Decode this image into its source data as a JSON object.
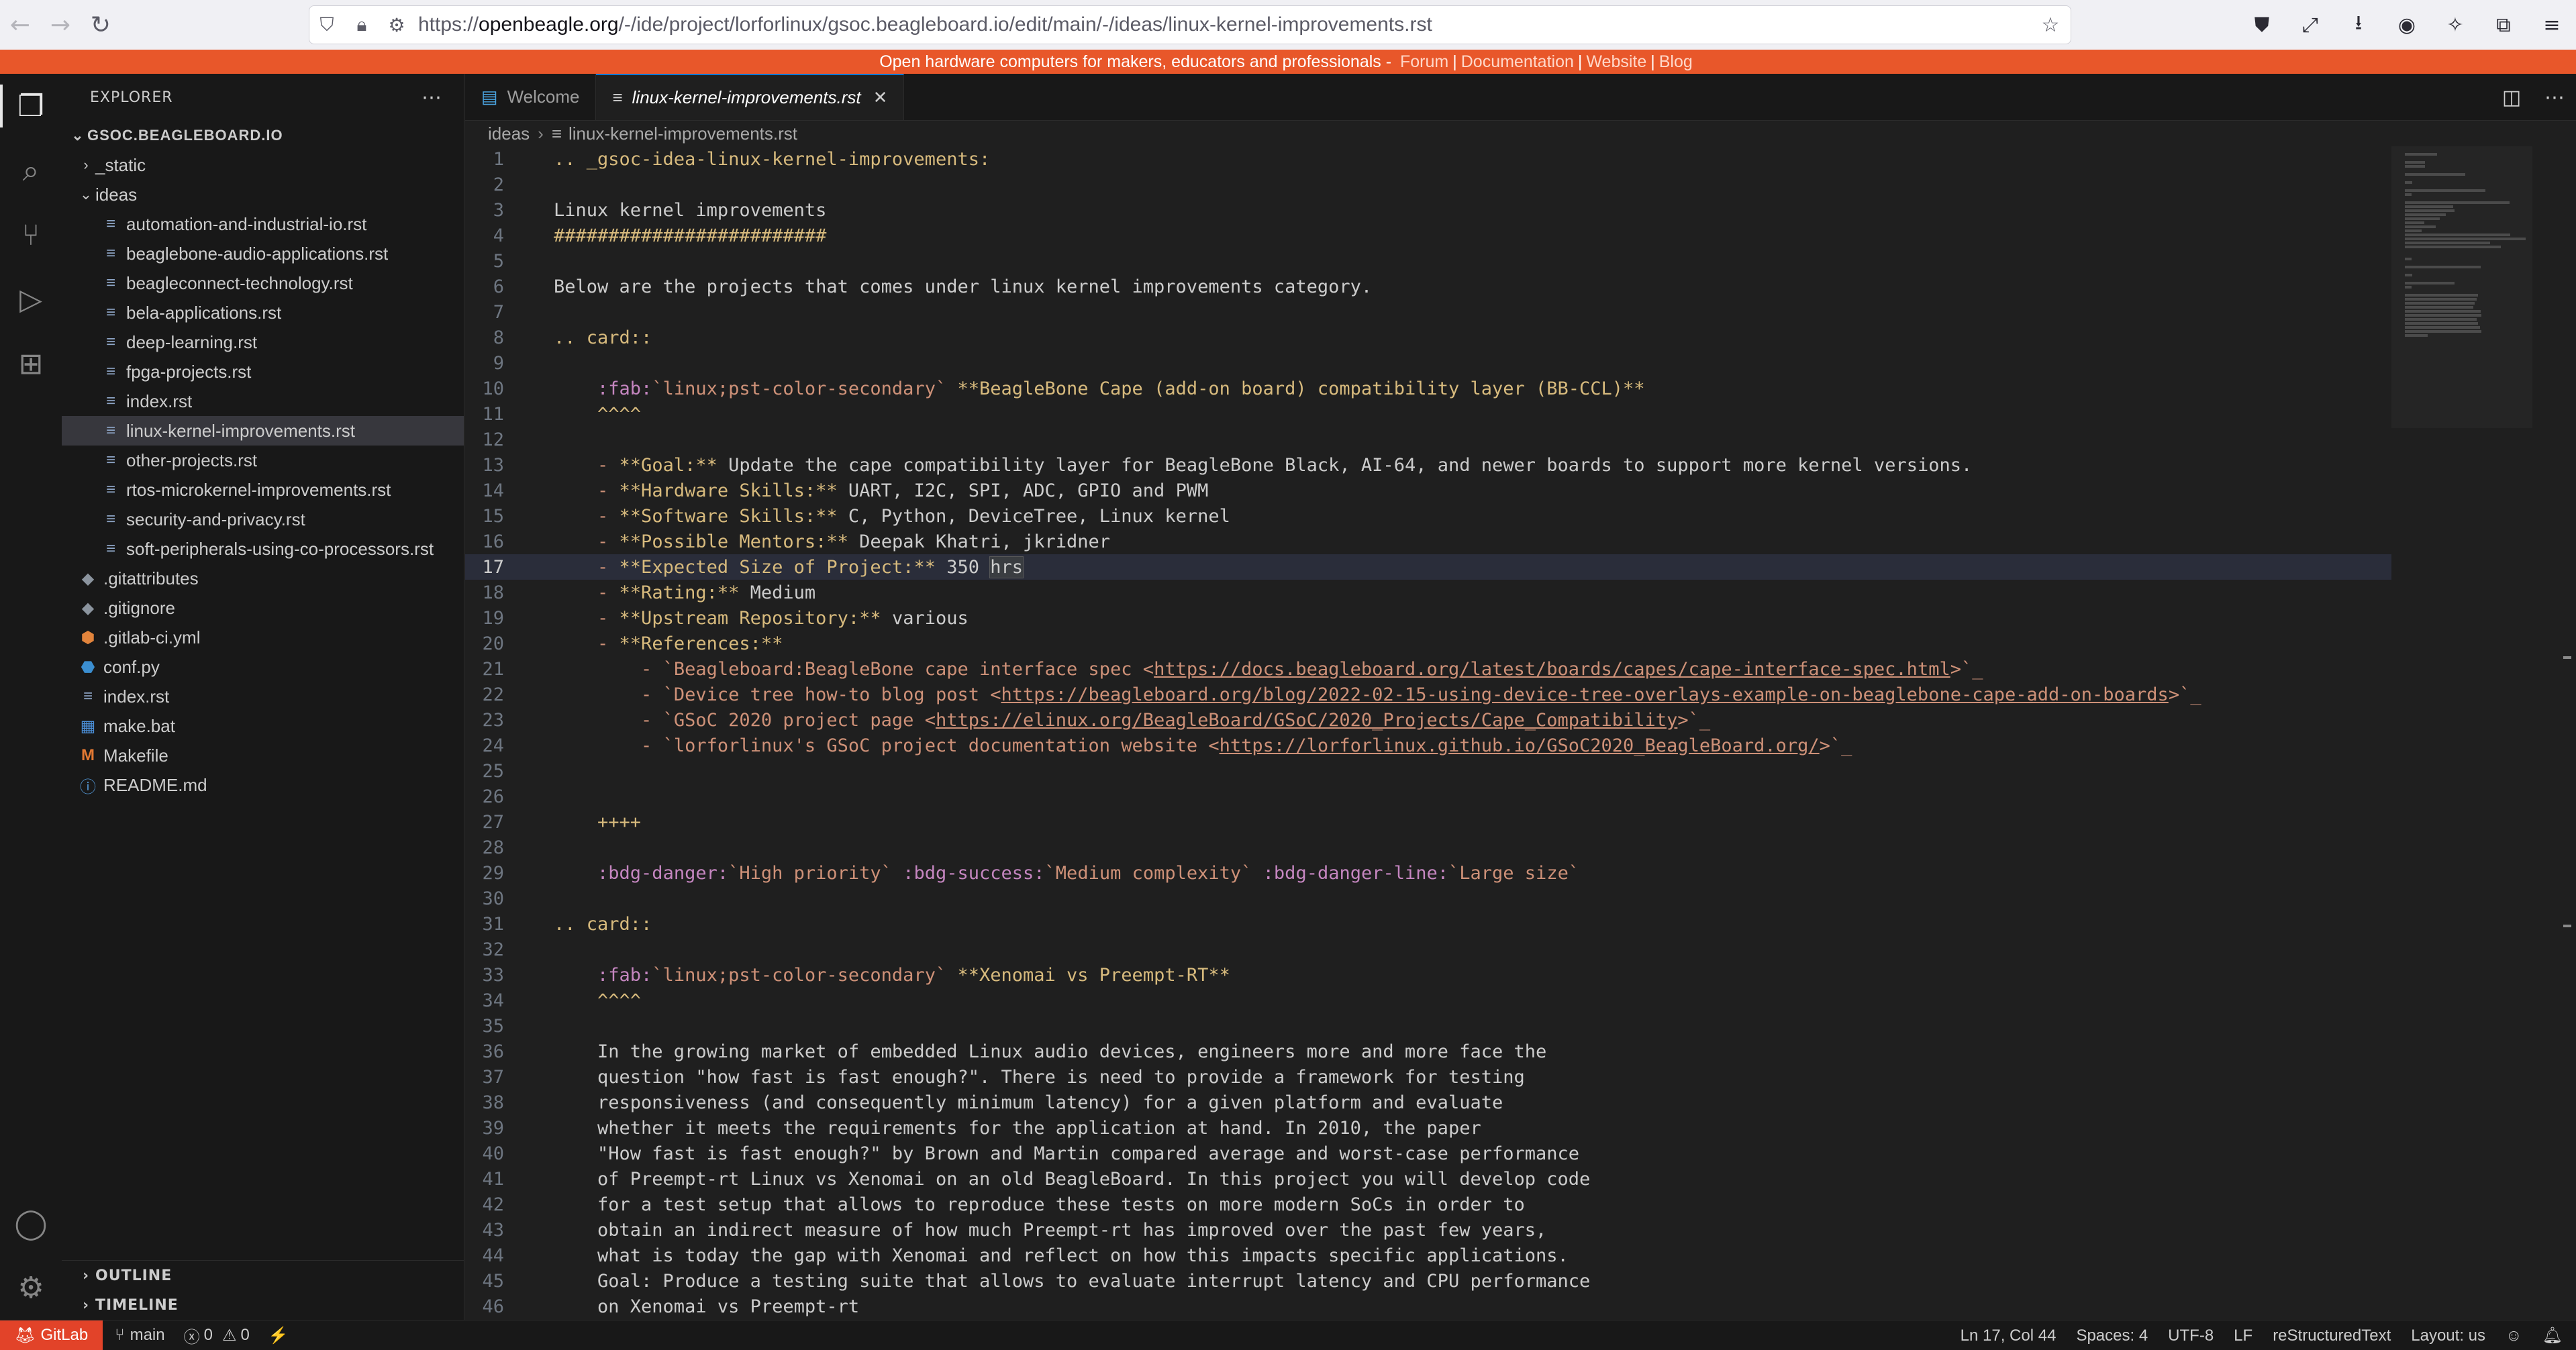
{
  "browser": {
    "url_prefix": "https://",
    "url_domain": "openbeagle.org",
    "url_path": "/-/ide/project/lorforlinux/gsoc.beagleboard.io/edit/main/-/ideas/linux-kernel-improvements.rst"
  },
  "banner": {
    "text": "Open hardware computers for makers, educators and professionals - ",
    "links": [
      "Forum",
      "Documentation",
      "Website",
      "Blog"
    ]
  },
  "sidebar": {
    "title": "EXPLORER",
    "root": "GSOC.BEAGLEBOARD.IO",
    "tree": [
      {
        "label": "_static",
        "type": "folder",
        "depth": 1,
        "open": false
      },
      {
        "label": "ideas",
        "type": "folder",
        "depth": 1,
        "open": true
      },
      {
        "label": "automation-and-industrial-io.rst",
        "type": "doc",
        "depth": 2
      },
      {
        "label": "beaglebone-audio-applications.rst",
        "type": "doc",
        "depth": 2
      },
      {
        "label": "beagleconnect-technology.rst",
        "type": "doc",
        "depth": 2
      },
      {
        "label": "bela-applications.rst",
        "type": "doc",
        "depth": 2
      },
      {
        "label": "deep-learning.rst",
        "type": "doc",
        "depth": 2
      },
      {
        "label": "fpga-projects.rst",
        "type": "doc",
        "depth": 2
      },
      {
        "label": "index.rst",
        "type": "doc",
        "depth": 2
      },
      {
        "label": "linux-kernel-improvements.rst",
        "type": "doc",
        "depth": 2,
        "selected": true
      },
      {
        "label": "other-projects.rst",
        "type": "doc",
        "depth": 2
      },
      {
        "label": "rtos-microkernel-improvements.rst",
        "type": "doc",
        "depth": 2
      },
      {
        "label": "security-and-privacy.rst",
        "type": "doc",
        "depth": 2
      },
      {
        "label": "soft-peripherals-using-co-processors.rst",
        "type": "doc",
        "depth": 2
      },
      {
        "label": ".gitattributes",
        "type": "git",
        "depth": 1
      },
      {
        "label": ".gitignore",
        "type": "git",
        "depth": 1
      },
      {
        "label": ".gitlab-ci.yml",
        "type": "gl",
        "depth": 1
      },
      {
        "label": "conf.py",
        "type": "py",
        "depth": 1
      },
      {
        "label": "index.rst",
        "type": "doc",
        "depth": 1
      },
      {
        "label": "make.bat",
        "type": "bat",
        "depth": 1
      },
      {
        "label": "Makefile",
        "type": "mk",
        "depth": 1
      },
      {
        "label": "README.md",
        "type": "md",
        "depth": 1
      }
    ],
    "outline": "OUTLINE",
    "timeline": "TIMELINE"
  },
  "tabs": [
    {
      "label": "Welcome",
      "active": false
    },
    {
      "label": "linux-kernel-improvements.rst",
      "active": true
    }
  ],
  "breadcrumb": {
    "folder": "ideas",
    "file": "linux-kernel-improvements.rst"
  },
  "editor": {
    "current_line": 17,
    "lines": [
      [
        [
          "c-dir",
          ".. _gsoc-idea-linux-kernel-improvements:"
        ]
      ],
      [],
      [
        [
          "c-txt",
          "Linux kernel improvements"
        ]
      ],
      [
        [
          "c-head",
          "#########################"
        ]
      ],
      [],
      [
        [
          "c-txt",
          "Below are the projects that comes under linux kernel improvements category."
        ]
      ],
      [],
      [
        [
          "c-dir",
          ".. card::"
        ]
      ],
      [],
      [
        [
          "c-txt",
          "    "
        ],
        [
          "c-role",
          ":fab:"
        ],
        [
          "c-str",
          "`linux;pst-color-secondary`"
        ],
        [
          "c-bold",
          " **BeagleBone Cape (add-on board) compatibility layer (BB-CCL)**"
        ]
      ],
      [
        [
          "c-head",
          "    ^^^^"
        ]
      ],
      [],
      [
        [
          "c-bullet",
          "    - "
        ],
        [
          "c-bold",
          "**Goal:**"
        ],
        [
          "c-txt",
          " Update the cape compatibility layer for BeagleBone Black, AI-64, and newer boards to support more kernel versions."
        ]
      ],
      [
        [
          "c-bullet",
          "    - "
        ],
        [
          "c-bold",
          "**Hardware Skills:**"
        ],
        [
          "c-txt",
          " UART, I2C, SPI, ADC, GPIO and PWM"
        ]
      ],
      [
        [
          "c-bullet",
          "    - "
        ],
        [
          "c-bold",
          "**Software Skills:**"
        ],
        [
          "c-txt",
          " C, Python, DeviceTree, Linux kernel"
        ]
      ],
      [
        [
          "c-bullet",
          "    - "
        ],
        [
          "c-bold",
          "**Possible Mentors:**"
        ],
        [
          "c-txt",
          " Deepak Khatri, jkridner"
        ]
      ],
      [
        [
          "c-bullet",
          "    - "
        ],
        [
          "c-bold",
          "**Expected Size of Project:**"
        ],
        [
          "c-txt",
          " 350 "
        ],
        [
          "c-txt c-hl",
          "hrs"
        ]
      ],
      [
        [
          "c-bullet",
          "    - "
        ],
        [
          "c-bold",
          "**Rating:**"
        ],
        [
          "c-txt",
          " Medium"
        ]
      ],
      [
        [
          "c-bullet",
          "    - "
        ],
        [
          "c-bold",
          "**Upstream Repository:**"
        ],
        [
          "c-txt",
          " various"
        ]
      ],
      [
        [
          "c-bullet",
          "    - "
        ],
        [
          "c-bold",
          "**References:**"
        ]
      ],
      [
        [
          "c-bullet",
          "        - "
        ],
        [
          "c-str",
          "`Beagleboard:BeagleBone cape interface spec <"
        ],
        [
          "c-url",
          "https://docs.beagleboard.org/latest/boards/capes/cape-interface-spec.html"
        ],
        [
          "c-str",
          ">`_"
        ]
      ],
      [
        [
          "c-bullet",
          "        - "
        ],
        [
          "c-str",
          "`Device tree how-to blog post <"
        ],
        [
          "c-url",
          "https://beagleboard.org/blog/2022-02-15-using-device-tree-overlays-example-on-beaglebone-cape-add-on-boards"
        ],
        [
          "c-str",
          ">`_"
        ]
      ],
      [
        [
          "c-bullet",
          "        - "
        ],
        [
          "c-str",
          "`GSoC 2020 project page <"
        ],
        [
          "c-url",
          "https://elinux.org/BeagleBoard/GSoC/2020_Projects/Cape_Compatibility"
        ],
        [
          "c-str",
          ">`_"
        ]
      ],
      [
        [
          "c-bullet",
          "        - "
        ],
        [
          "c-str",
          "`lorforlinux's GSoC project documentation website <"
        ],
        [
          "c-url",
          "https://lorforlinux.github.io/GSoC2020_BeagleBoard.org/"
        ],
        [
          "c-str",
          ">`_"
        ]
      ],
      [],
      [],
      [
        [
          "c-head",
          "    ++++"
        ]
      ],
      [],
      [
        [
          "c-txt",
          "    "
        ],
        [
          "c-role",
          ":bdg-danger:"
        ],
        [
          "c-str",
          "`High priority`"
        ],
        [
          "c-txt",
          " "
        ],
        [
          "c-role",
          ":bdg-success:"
        ],
        [
          "c-str",
          "`Medium complexity`"
        ],
        [
          "c-txt",
          " "
        ],
        [
          "c-role",
          ":bdg-danger-line:"
        ],
        [
          "c-str",
          "`Large size`"
        ]
      ],
      [],
      [
        [
          "c-dir",
          ".. card::"
        ]
      ],
      [],
      [
        [
          "c-txt",
          "    "
        ],
        [
          "c-role",
          ":fab:"
        ],
        [
          "c-str",
          "`linux;pst-color-secondary`"
        ],
        [
          "c-bold",
          " **Xenomai vs Preempt-RT**"
        ]
      ],
      [
        [
          "c-head",
          "    ^^^^"
        ]
      ],
      [],
      [
        [
          "c-txt",
          "    In the growing market of embedded Linux audio devices, engineers more and more face the"
        ]
      ],
      [
        [
          "c-txt",
          "    question \"how fast is fast enough?\". There is need to provide a framework for testing"
        ]
      ],
      [
        [
          "c-txt",
          "    responsiveness (and consequently minimum latency) for a given platform and evaluate"
        ]
      ],
      [
        [
          "c-txt",
          "    whether it meets the requirements for the application at hand. In 2010, the paper"
        ]
      ],
      [
        [
          "c-txt",
          "    \"How fast is fast enough?\" by Brown and Martin compared average and worst-case performance"
        ]
      ],
      [
        [
          "c-txt",
          "    of Preempt-rt Linux vs Xenomai on an old BeagleBoard. In this project you will develop code"
        ]
      ],
      [
        [
          "c-txt",
          "    for a test setup that allows to reproduce these tests on more modern SoCs in order to"
        ]
      ],
      [
        [
          "c-txt",
          "    obtain an indirect measure of how much Preempt-rt has improved over the past few years,"
        ]
      ],
      [
        [
          "c-txt",
          "    what is today the gap with Xenomai and reflect on how this impacts specific applications."
        ]
      ],
      [
        [
          "c-txt",
          "    Goal: Produce a testing suite that allows to evaluate interrupt latency and CPU performance"
        ]
      ],
      [
        [
          "c-txt",
          "    on Xenomai vs Preempt-rt"
        ]
      ]
    ]
  },
  "status": {
    "remote": "GitLab",
    "branch": "main",
    "errors": "0",
    "warnings": "0",
    "position": "Ln 17, Col 44",
    "spaces": "Spaces: 4",
    "encoding": "UTF-8",
    "eol": "LF",
    "language": "reStructuredText",
    "layout": "Layout: us"
  },
  "colors": {
    "banner": "#e8572a",
    "remote": "#e24329",
    "accent": "#0078d4"
  }
}
